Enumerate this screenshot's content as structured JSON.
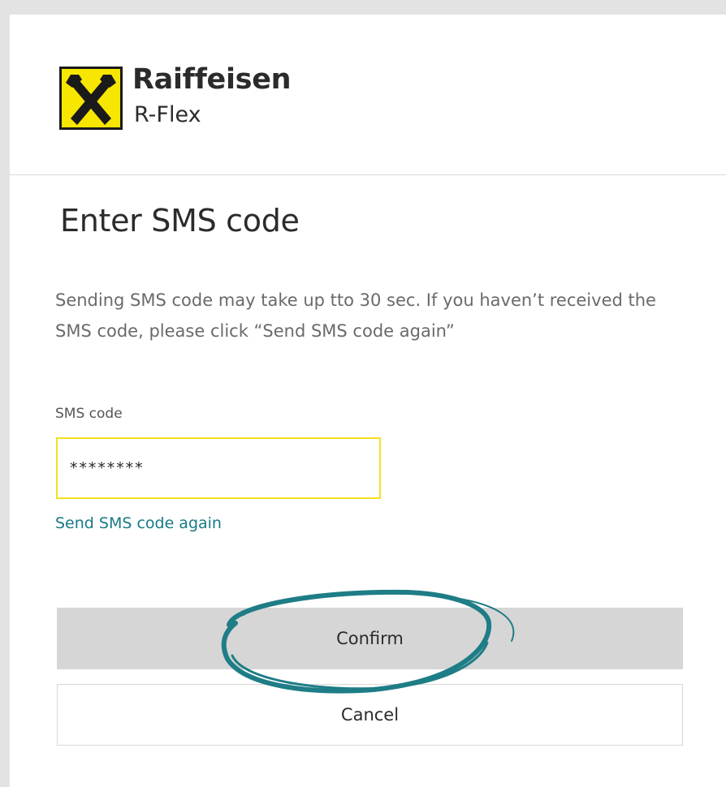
{
  "brand": {
    "name": "Raiffeisen",
    "product": "R-Flex",
    "logo_icon": "raiffeisen-crossed-horse-heads",
    "logo_color": "#f7e600"
  },
  "page": {
    "title": "Enter SMS code",
    "info": "Sending SMS code may take up tto 30 sec. If you haven’t received the SMS code, please click “Send SMS code again”"
  },
  "sms_field": {
    "label": "SMS code",
    "value": "********"
  },
  "resend_link": {
    "label": "Send SMS code again"
  },
  "buttons": {
    "confirm": "Confirm",
    "cancel": "Cancel"
  },
  "colors": {
    "accent_yellow": "#f5df1f",
    "link_teal": "#177a86",
    "annotation_teal": "#1e7d86",
    "confirm_bg": "#d6d6d6"
  }
}
